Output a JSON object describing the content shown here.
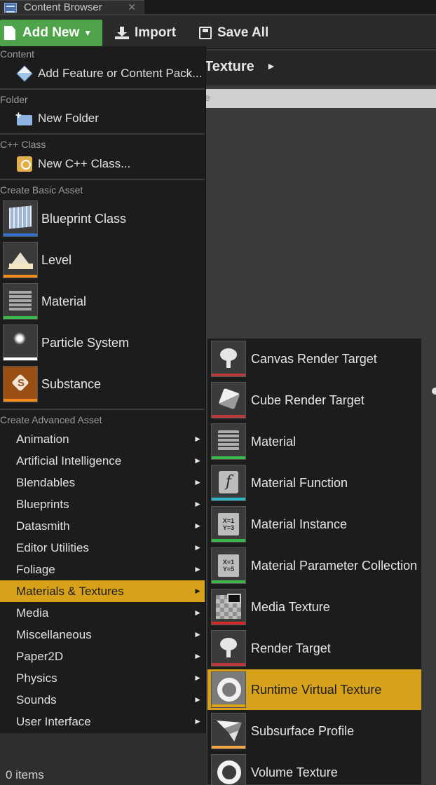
{
  "tab": {
    "title": "Content Browser",
    "close": "✕"
  },
  "toolbar": {
    "add_new": "Add New",
    "import": "Import",
    "save_all": "Save All"
  },
  "path": {
    "current": "Texture",
    "arrow": "►"
  },
  "filter": {
    "partial": "e"
  },
  "status": {
    "items": "0 items"
  },
  "menu": {
    "sections": {
      "content": "Content",
      "folder": "Folder",
      "cpp": "C++ Class",
      "basic": "Create Basic Asset",
      "advanced": "Create Advanced Asset"
    },
    "add_feature": "Add Feature or Content Pack...",
    "new_folder": "New Folder",
    "new_cpp": "New C++ Class...",
    "basic_assets": [
      {
        "label": "Blueprint Class",
        "icon": "blueprint-class-icon",
        "bar_color": "#2f6fd0"
      },
      {
        "label": "Level",
        "icon": "level-icon",
        "bar_color": "#f08a1c"
      },
      {
        "label": "Material",
        "icon": "material-icon",
        "bar_color": "#3cb84a"
      },
      {
        "label": "Particle System",
        "icon": "particle-system-icon",
        "bar_color": "#ffffff"
      },
      {
        "label": "Substance",
        "icon": "substance-icon",
        "bar_color": "#f08a1c"
      }
    ],
    "advanced_assets": [
      "Animation",
      "Artificial Intelligence",
      "Blendables",
      "Blueprints",
      "Datasmith",
      "Editor Utilities",
      "Foliage",
      "Materials & Textures",
      "Media",
      "Miscellaneous",
      "Paper2D",
      "Physics",
      "Sounds",
      "User Interface"
    ],
    "advanced_selected": "Materials & Textures"
  },
  "submenu": {
    "items": [
      {
        "label": "Canvas Render Target",
        "icon": "canvas-render-target-icon",
        "bar_color": "#b83a3a"
      },
      {
        "label": "Cube Render Target",
        "icon": "cube-render-target-icon",
        "bar_color": "#b83a3a"
      },
      {
        "label": "Material",
        "icon": "material-icon",
        "bar_color": "#3cb84a"
      },
      {
        "label": "Material Function",
        "icon": "material-function-icon",
        "bar_color": "#2bb6c4"
      },
      {
        "label": "Material Instance",
        "icon": "material-instance-icon",
        "bar_color": "#3cb84a"
      },
      {
        "label": "Material Parameter Collection",
        "icon": "material-parameter-collection-icon",
        "bar_color": "#3cb84a"
      },
      {
        "label": "Media Texture",
        "icon": "media-texture-icon",
        "bar_color": "#d02a2a"
      },
      {
        "label": "Render Target",
        "icon": "render-target-icon",
        "bar_color": "#b83a3a"
      },
      {
        "label": "Runtime Virtual Texture",
        "icon": "runtime-virtual-texture-icon",
        "bar_color": "#d7a11a"
      },
      {
        "label": "Subsurface Profile",
        "icon": "subsurface-profile-icon",
        "bar_color": "#f0a44a"
      },
      {
        "label": "Volume Texture",
        "icon": "volume-texture-icon",
        "bar_color": "#b83a3a"
      }
    ],
    "selected": "Runtime Virtual Texture"
  }
}
